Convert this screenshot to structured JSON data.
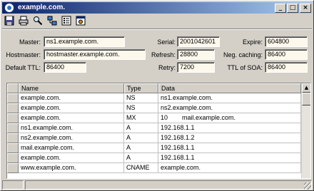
{
  "window": {
    "title": "example.com."
  },
  "titlebar_buttons": {
    "minimize": "_",
    "maximize": "□",
    "close": "×"
  },
  "toolbar": [
    {
      "name": "save-icon"
    },
    {
      "name": "print-icon"
    },
    {
      "name": "search-icon"
    },
    {
      "name": "network-icon"
    },
    {
      "name": "list-icon"
    },
    {
      "name": "properties-icon"
    }
  ],
  "soa": {
    "master": {
      "label": "Master:",
      "value": "ns1.example.com."
    },
    "hostmaster": {
      "label": "Hostmaster:",
      "value": "hostmaster.example.com."
    },
    "default_ttl": {
      "label": "Default TTL:",
      "value": "86400"
    },
    "serial": {
      "label": "Serial:",
      "value": "2001042601"
    },
    "refresh": {
      "label": "Refresh:",
      "value": "28800"
    },
    "retry": {
      "label": "Retry:",
      "value": "7200"
    },
    "expire": {
      "label": "Expire:",
      "value": "604800"
    },
    "neg_caching": {
      "label": "Neg. caching:",
      "value": "86400"
    },
    "ttl_soa": {
      "label": "TTL of SOA:",
      "value": "86400"
    }
  },
  "table": {
    "headers": [
      "Name",
      "Type",
      "Data"
    ],
    "rows": [
      {
        "name": "example.com.",
        "type": "NS",
        "pref": "",
        "data": "ns1.example.com."
      },
      {
        "name": "example.com.",
        "type": "NS",
        "pref": "",
        "data": "ns2.example.com."
      },
      {
        "name": "example.com.",
        "type": "MX",
        "pref": "10",
        "data": "mail.example.com."
      },
      {
        "name": "ns1.example.com.",
        "type": "A",
        "pref": "",
        "data": "192.168.1.1"
      },
      {
        "name": "ns2.example.com.",
        "type": "A",
        "pref": "",
        "data": "192.168.1.2"
      },
      {
        "name": "mail.example.com.",
        "type": "A",
        "pref": "",
        "data": "192.168.1.1"
      },
      {
        "name": "example.com.",
        "type": "A",
        "pref": "",
        "data": "192.168.1.1"
      },
      {
        "name": "www.example.com.",
        "type": "CNAME",
        "pref": "",
        "data": "example.com."
      }
    ]
  },
  "scrollbar": {
    "up": "▲"
  }
}
